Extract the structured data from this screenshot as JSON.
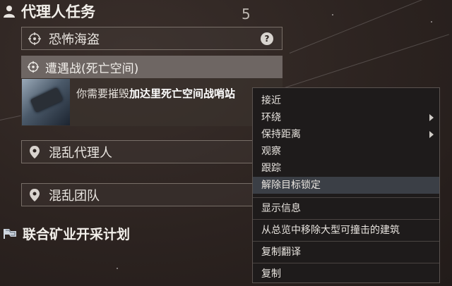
{
  "agent_missions": {
    "title": "代理人任务",
    "step": "5",
    "items": [
      {
        "label": "恐怖海盗",
        "badge": "?"
      },
      {
        "label": "遭遇战(死亡空间)"
      },
      {
        "label": "混乱代理人"
      },
      {
        "label": "混乱团队"
      }
    ],
    "objective": {
      "prefix": "你需要摧毁",
      "bold": "加达里死亡空间战哨站"
    }
  },
  "joint_mining": {
    "title": "联合矿业开采计划"
  },
  "context_menu": {
    "items": [
      {
        "label": "接近"
      },
      {
        "label": "环绕",
        "submenu": true
      },
      {
        "label": "保持距离",
        "submenu": true
      },
      {
        "label": "观察"
      },
      {
        "label": "跟踪"
      },
      {
        "label": "解除目标锁定",
        "active": true
      },
      {
        "label": "显示信息"
      },
      {
        "label": "从总览中移除大型可撞击的建筑"
      },
      {
        "label": "复制翻译"
      },
      {
        "label": "复制"
      }
    ]
  },
  "colors": {
    "background": "#2c2320",
    "menu_bg": "#1e1b1b",
    "highlight": "#3b3f46",
    "encounter_bg": "#6e6663"
  },
  "icons": {
    "person": "person-icon",
    "target": "crosshair-icon",
    "location": "map-pin-icon",
    "flag": "flag-icon",
    "submenu": "chevron-right-icon"
  }
}
